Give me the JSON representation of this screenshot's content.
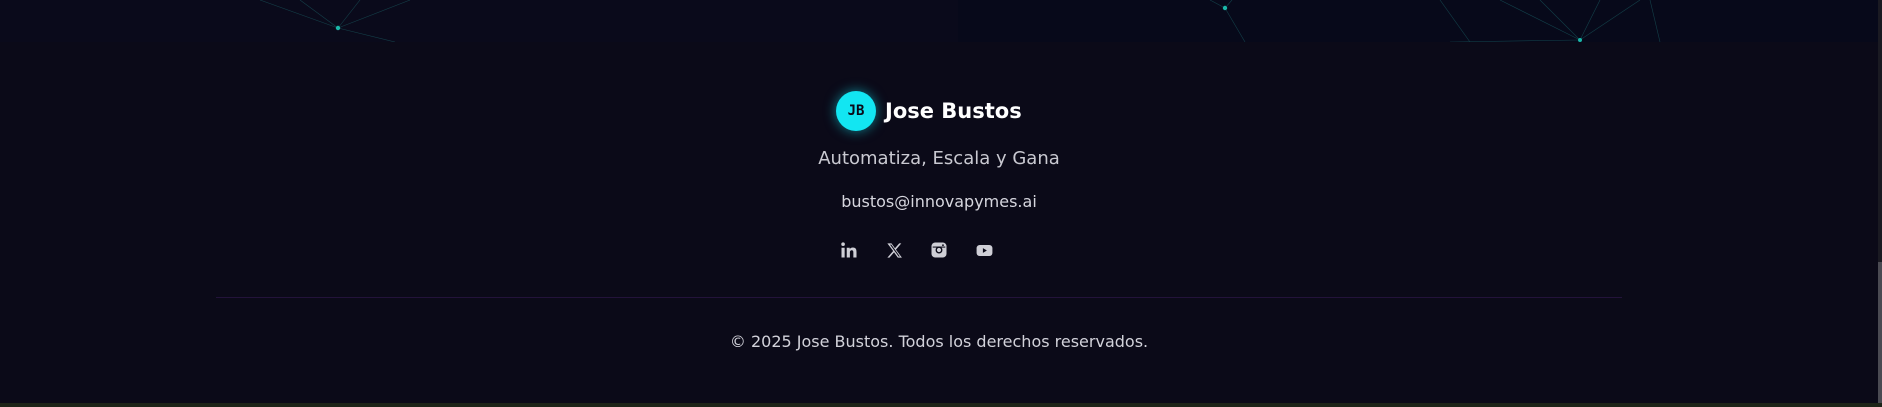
{
  "brand": {
    "initials": "JB",
    "name": "Jose Bustos"
  },
  "footer": {
    "tagline": "Automatiza, Escala y Gana",
    "email": "bustos@innovapymes.ai",
    "copyright": "© 2025 Jose Bustos. Todos los derechos reservados."
  },
  "socials": [
    {
      "name": "linkedin-icon"
    },
    {
      "name": "x-twitter-icon"
    },
    {
      "name": "instagram-icon"
    },
    {
      "name": "youtube-icon"
    }
  ],
  "colors": {
    "accent": "#12e6f2",
    "background": "#0b0a18",
    "divider": "#23133a",
    "text": "#c9c9d1"
  }
}
